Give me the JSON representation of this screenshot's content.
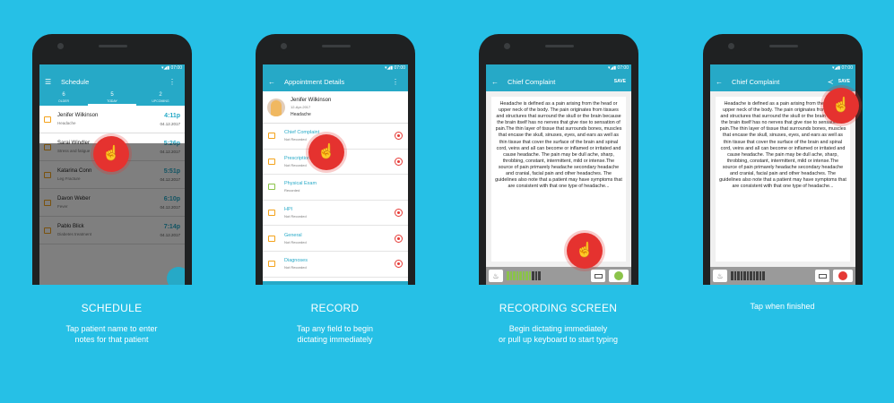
{
  "panels": {
    "schedule": {
      "status_time": "07:00",
      "title": "Schedule",
      "tabs": [
        {
          "count": "6",
          "label": "OLDER"
        },
        {
          "count": "5",
          "label": "TODAY"
        },
        {
          "count": "2",
          "label": "UPCOMING"
        }
      ],
      "patients": [
        {
          "name": "Jenifer Wilkinson",
          "condition": "Headache",
          "time": "4:11p",
          "date": "04.12.2017"
        },
        {
          "name": "Sarai Windler",
          "condition": "Stress and fatigue",
          "time": "5:26p",
          "date": "04.12.2017"
        },
        {
          "name": "Katarina Conn",
          "condition": "Leg Fracture",
          "time": "5:51p",
          "date": "04.12.2017"
        },
        {
          "name": "Davon Weber",
          "condition": "Fever",
          "time": "6:10p",
          "date": "04.12.2017"
        },
        {
          "name": "Pablo Blick",
          "condition": "Diabetes treatment",
          "time": "7:14p",
          "date": "04.12.2017"
        }
      ],
      "caption_title": "SCHEDULE",
      "caption_lines": [
        "Tap patient name to enter",
        "notes for that patient"
      ]
    },
    "record": {
      "status_time": "07:00",
      "title": "Appointment Details",
      "patient_name": "Jenifer Wilkinson",
      "patient_date": "12-Apr-2017",
      "patient_condition": "Headache",
      "fields": [
        {
          "label": "Chief Complaint",
          "status": "Not Recorded"
        },
        {
          "label": "Prescription",
          "status": "Not Recorded"
        },
        {
          "label": "Physical Exam",
          "status": "Recorded"
        },
        {
          "label": "HPI",
          "status": "Not Recorded"
        },
        {
          "label": "General",
          "status": "Not Recorded"
        },
        {
          "label": "Diagnoses",
          "status": "Not Recorded"
        }
      ],
      "caption_title": "RECORD",
      "caption_lines": [
        "Tap any field to begin",
        "dictating immediately"
      ]
    },
    "recording": {
      "status_time": "07:00",
      "title": "Chief Complaint",
      "action": "SAVE",
      "note_text": "Headache is defined as a pain arising from the head or upper neck of the body. The pain originates from tissues and structures that surround the skull or the brain because the brain itself has no nerves that give rise to sensation of pain.The thin layer of tissue that surrounds bones, muscles that encase the skull, sinuses, eyes, and ears as well as thin tissue that cover the surface of the brain and spinal cord, veins and all can become or inflamed or irritated and cause headache. The pain may be dull ache, sharp, throbbing, constant, intermittent, mild or intense.The source of pain primarely headache secondary headache and cranial, facial pain and other headaches. The guidelines also note that a patient may have symptoms that are consistent with that one type of headache...",
      "caption_title": "RECORDING SCREEN",
      "caption_lines": [
        "Begin dictating immediately",
        "or pull up keyboard to start typing"
      ]
    },
    "finish": {
      "status_time": "07:00",
      "title": "Chief Complaint",
      "action": "SAVE",
      "note_text": "Headache is defined as a pain arising from the head or upper neck of the body. The pain originates from tissues and structures that surround the skull or the brain because the brain itself has no nerves that give rise to sensation of pain.The thin layer of tissue that surrounds bones, muscles that encase the skull, sinuses, eyes, and ears as well as thin tissue that cover the surface of the brain and spinal cord, veins and all can become or inflamed or irritated and cause headache. The pain may be dull ache, sharp, throbbing, constant, intermittent, mild or intense.The source of pain primarely headache secondary headache and cranial, facial pain and other headaches. The guidelines also note that a patient may have symptoms that are consistent with that one type of headache...",
      "caption_title": "",
      "caption_lines": [
        "Tap when finished"
      ]
    }
  },
  "colors": {
    "background": "#26c0e6",
    "app_bar": "#26a9c7",
    "accent_orange": "#f3a21a",
    "record_red": "#e53935",
    "mic_green": "#8bc34a"
  },
  "icons": {
    "menu": "menu-icon",
    "back": "back-arrow-icon",
    "more": "more-vert-icon",
    "share": "share-icon",
    "touch": "tap-hand-icon",
    "mic": "microphone-icon",
    "keyboard": "keyboard-icon"
  }
}
